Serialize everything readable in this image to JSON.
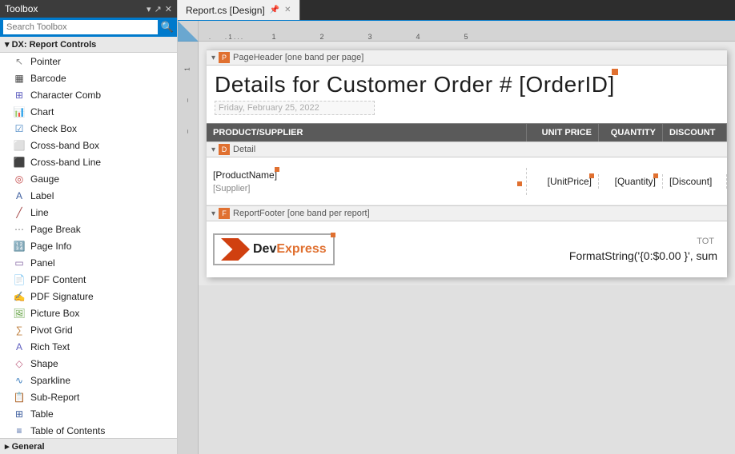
{
  "toolbox": {
    "title": "Toolbox",
    "titlebar_icons": [
      "▾",
      "↗",
      "✕"
    ],
    "search_placeholder": "Search Toolbox",
    "section_header": "▾ DX: Report Controls",
    "items": [
      {
        "label": "Pointer",
        "icon": "↖",
        "id": "pointer"
      },
      {
        "label": "Barcode",
        "icon": "▦",
        "id": "barcode"
      },
      {
        "label": "Character Comb",
        "icon": "⊞",
        "id": "character-comb"
      },
      {
        "label": "Chart",
        "icon": "📊",
        "id": "chart"
      },
      {
        "label": "Check Box",
        "icon": "☑",
        "id": "check-box"
      },
      {
        "label": "Cross-band Box",
        "icon": "⬜",
        "id": "cross-band-box"
      },
      {
        "label": "Cross-band Line",
        "icon": "—",
        "id": "cross-band-line"
      },
      {
        "label": "Gauge",
        "icon": "◎",
        "id": "gauge"
      },
      {
        "label": "Label",
        "icon": "A",
        "id": "label"
      },
      {
        "label": "Line",
        "icon": "╱",
        "id": "line"
      },
      {
        "label": "Page Break",
        "icon": "⋯",
        "id": "page-break"
      },
      {
        "label": "Page Info",
        "icon": "🔢",
        "id": "page-info"
      },
      {
        "label": "Panel",
        "icon": "▭",
        "id": "panel"
      },
      {
        "label": "PDF Content",
        "icon": "📄",
        "id": "pdf-content"
      },
      {
        "label": "PDF Signature",
        "icon": "✍",
        "id": "pdf-signature"
      },
      {
        "label": "Picture Box",
        "icon": "🖼",
        "id": "picture-box"
      },
      {
        "label": "Pivot Grid",
        "icon": "∑",
        "id": "pivot-grid"
      },
      {
        "label": "Rich Text",
        "icon": "A",
        "id": "rich-text"
      },
      {
        "label": "Shape",
        "icon": "◇",
        "id": "shape"
      },
      {
        "label": "Sparkline",
        "icon": "∿",
        "id": "sparkline"
      },
      {
        "label": "Sub-Report",
        "icon": "📋",
        "id": "sub-report"
      },
      {
        "label": "Table",
        "icon": "⊞",
        "id": "table"
      },
      {
        "label": "Table of Contents",
        "icon": "≡",
        "id": "table-of-contents"
      }
    ],
    "general_section": "▸ General"
  },
  "tabs": [
    {
      "label": "Report.cs [Design]",
      "active": true,
      "id": "design-tab",
      "pin": "📌"
    },
    {
      "label": "✕",
      "id": "close-tab"
    }
  ],
  "report": {
    "ruler_marks": [
      ". 1 . . .",
      "1",
      "2",
      "3",
      "4",
      "5"
    ],
    "page_header_band": "PageHeader [one band per page]",
    "title": "Details for Customer Order # [OrderID]",
    "date_placeholder": "Friday, February 25, 2022",
    "columns": [
      {
        "label": "PRODUCT/SUPPLIER",
        "id": "col-product"
      },
      {
        "label": "UNIT PRICE",
        "id": "col-unitprice"
      },
      {
        "label": "QUANTITY",
        "id": "col-quantity"
      },
      {
        "label": "DISCOUNT",
        "id": "col-discount"
      }
    ],
    "detail_band": "Detail",
    "product_name_field": "[ProductName]",
    "supplier_field": "[Supplier]",
    "unit_price_field": "[UnitPrice]",
    "quantity_field": "[Quantity]",
    "discount_field": "[Discount]",
    "report_footer_band": "ReportFooter [one band per report]",
    "total_label": "TOT",
    "formula": "FormatString('{0:$0.00 }', sum",
    "logo_text": "DevExpress"
  }
}
